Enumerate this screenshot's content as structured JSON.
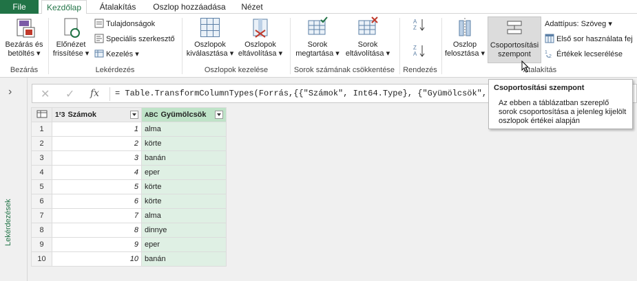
{
  "tabs": {
    "file": "File",
    "home": "Kezdőlap",
    "transform": "Átalakítás",
    "add_column": "Oszlop hozzáadása",
    "view": "Nézet"
  },
  "ribbon": {
    "close_load": "Bezárás és\nbetöltés",
    "close_load_line1": "Bezárás és",
    "close_load_line2": "betöltés",
    "group_close": "Bezárás",
    "refresh_line1": "Előnézet",
    "refresh_line2": "frissítése",
    "properties": "Tulajdonságok",
    "advanced_editor": "Speciális szerkesztő",
    "manage": "Kezelés",
    "group_query": "Lekérdezés",
    "choose_cols_line1": "Oszlopok",
    "choose_cols_line2": "kiválasztása",
    "remove_cols_line1": "Oszlopok",
    "remove_cols_line2": "eltávolítása",
    "group_manage_cols": "Oszlopok kezelése",
    "keep_rows_line1": "Sorok",
    "keep_rows_line2": "megtartása",
    "remove_rows_line1": "Sorok",
    "remove_rows_line2": "eltávolítása",
    "group_reduce_rows": "Sorok számának csökkentése",
    "group_sort": "Rendezés",
    "split_col_line1": "Oszlop",
    "split_col_line2": "felosztása",
    "group_by_line1": "Csoportosítási",
    "group_by_line2": "szempont",
    "data_type": "Adattípus: Szöveg",
    "first_row_headers": "Első sor használata fej",
    "replace_values": "Értékek lecserélése",
    "group_transform": "Átalakítás"
  },
  "side_pane": {
    "label": "Lekérdezések"
  },
  "formula_bar": {
    "formula": "= Table.TransformColumnTypes(Forrás,{{\"Számok\", Int64.Type}, {\"Gyümölcsök\", type t"
  },
  "table": {
    "col1_type": "1²3",
    "col1_header": "Számok",
    "col2_type": "ABC",
    "col2_header": "Gyümölcsök",
    "rows": [
      {
        "n": "1",
        "num": "1",
        "fruit": "alma"
      },
      {
        "n": "2",
        "num": "2",
        "fruit": "körte"
      },
      {
        "n": "3",
        "num": "3",
        "fruit": "banán"
      },
      {
        "n": "4",
        "num": "4",
        "fruit": "eper"
      },
      {
        "n": "5",
        "num": "5",
        "fruit": "körte"
      },
      {
        "n": "6",
        "num": "6",
        "fruit": "körte"
      },
      {
        "n": "7",
        "num": "7",
        "fruit": "alma"
      },
      {
        "n": "8",
        "num": "8",
        "fruit": "dinnye"
      },
      {
        "n": "9",
        "num": "9",
        "fruit": "eper"
      },
      {
        "n": "10",
        "num": "10",
        "fruit": "banán"
      }
    ]
  },
  "tooltip": {
    "title": "Csoportosítási szempont",
    "body": "Az ebben a táblázatban szereplő sorok csoportosítása a jelenleg kijelölt oszlopok értékei alapján"
  },
  "colors": {
    "accent": "#217346",
    "selected_column": "#dff0e4",
    "ribbon_bg": "#ffffff",
    "workspace_bg": "#f0f0f0"
  }
}
